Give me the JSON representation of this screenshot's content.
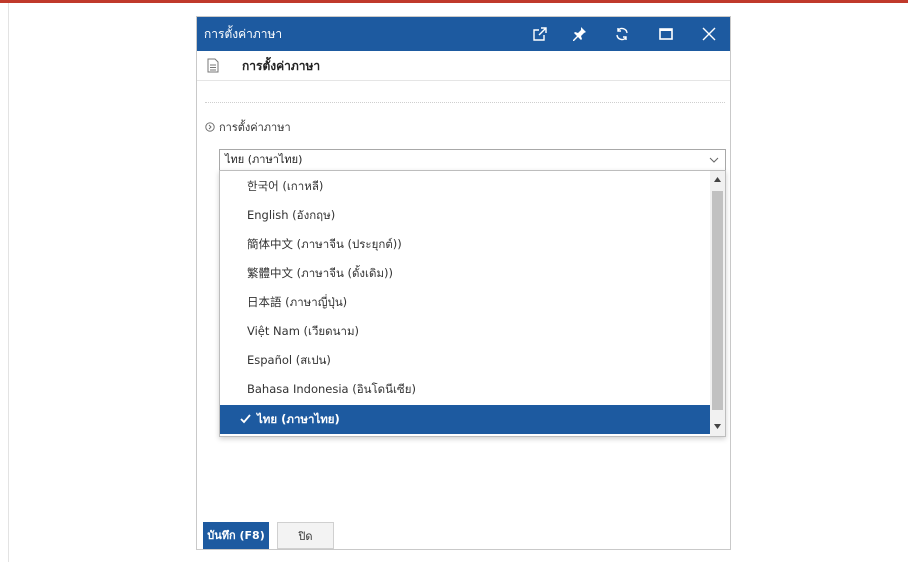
{
  "window": {
    "title": "การตั้งค่าภาษา",
    "controls": [
      "open-external",
      "pin",
      "refresh",
      "maximize",
      "close"
    ]
  },
  "subheader": {
    "title": "การตั้งค่าภาษา"
  },
  "section": {
    "label": "การตั้งค่าภาษา"
  },
  "language_select": {
    "value": "ไทย (ภาษาไทย)",
    "options": [
      "한국어 (เกาหลี)",
      "English (อังกฤษ)",
      "簡体中文 (ภาษาจีน (ประยุกต์))",
      "繁體中文 (ภาษาจีน (ดั้งเดิม))",
      "日本語 (ภาษาญี่ปุ่น)",
      "Việt Nam (เวียดนาม)",
      "Español (สเปน)",
      "Bahasa Indonesia (อินโดนีเซีย)",
      "ไทย (ภาษาไทย)"
    ],
    "selected_index": 8
  },
  "footer": {
    "save_label": "บันทึก (F8)",
    "close_label": "ปิด"
  },
  "colors": {
    "accent": "#1d5aa0",
    "top_border": "#c0392b"
  }
}
